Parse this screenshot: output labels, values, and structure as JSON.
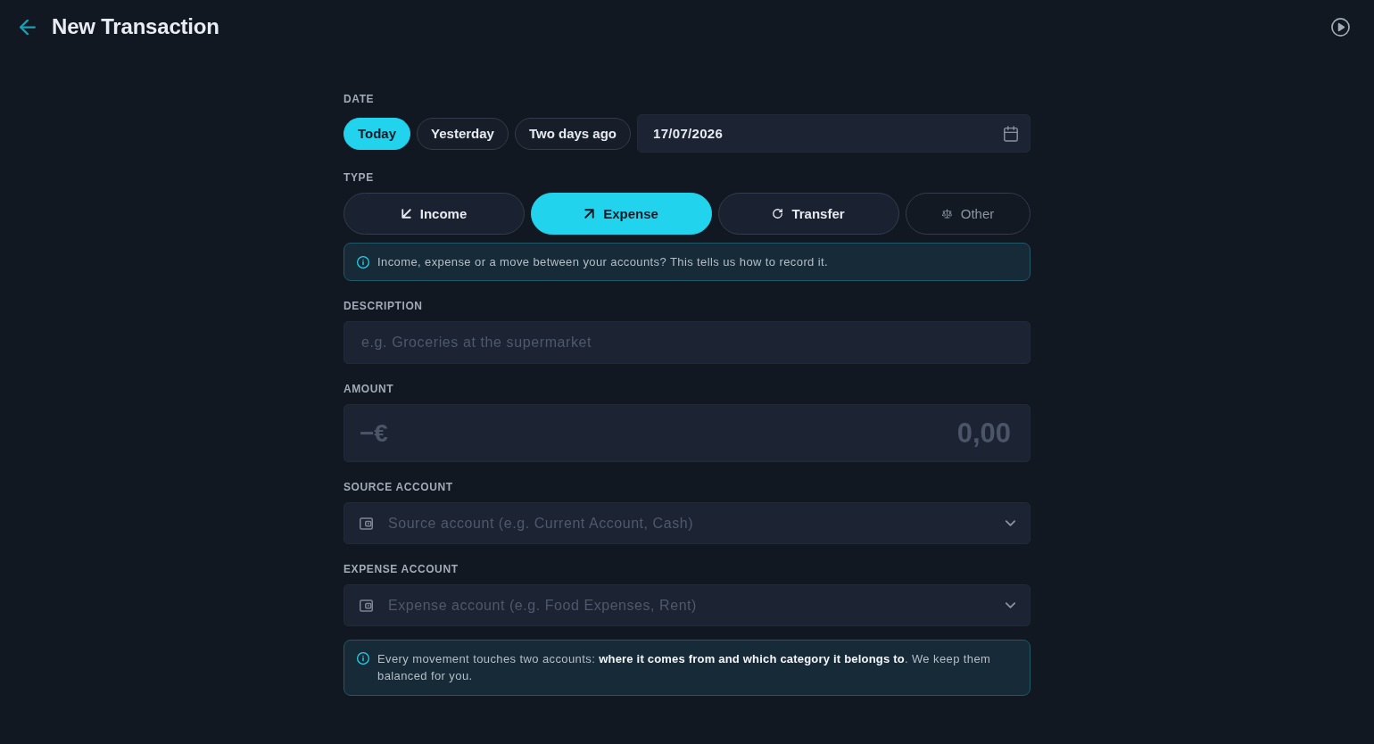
{
  "header": {
    "title": "New Transaction"
  },
  "date": {
    "label": "DATE",
    "presets": [
      {
        "label": "Today",
        "selected": true
      },
      {
        "label": "Yesterday",
        "selected": false
      },
      {
        "label": "Two days ago",
        "selected": false
      }
    ],
    "value": "17/07/2026"
  },
  "type": {
    "label": "TYPE",
    "options": [
      {
        "label": "Income",
        "selected": false,
        "disabled": false
      },
      {
        "label": "Expense",
        "selected": true,
        "disabled": false
      },
      {
        "label": "Transfer",
        "selected": false,
        "disabled": false
      },
      {
        "label": "Other",
        "selected": false,
        "disabled": true
      }
    ],
    "hint": "Income, expense or a move between your accounts? This tells us how to record it."
  },
  "description": {
    "label": "DESCRIPTION",
    "placeholder": "e.g. Groceries at the supermarket"
  },
  "amount": {
    "label": "AMOUNT",
    "prefix": "−€",
    "placeholder": "0,00"
  },
  "source_account": {
    "label": "SOURCE ACCOUNT",
    "placeholder": "Source account (e.g. Current Account, Cash)"
  },
  "expense_account": {
    "label": "EXPENSE ACCOUNT",
    "placeholder": "Expense account (e.g. Food Expenses, Rent)"
  },
  "note": "Every movement touches two accounts: **where it comes from and which category it belongs to**. We keep them balanced for you."
}
